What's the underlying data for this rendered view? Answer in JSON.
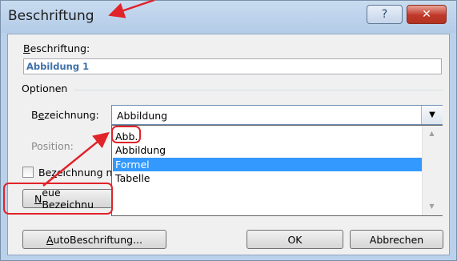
{
  "window": {
    "title": "Beschriftung",
    "help_glyph": "?",
    "close_glyph": "✕"
  },
  "caption": {
    "label_accel": "B",
    "label_rest": "eschriftung:",
    "value": "Abbildung 1"
  },
  "options": {
    "group_label": "Optionen",
    "label_field_pre": "B",
    "label_field_accel": "e",
    "label_field_post": "zeichnung:",
    "label_value": "Abbildung",
    "dropdown_arrow": "▼",
    "dropdown_items": [
      "Abb.",
      "Abbildung",
      "Formel",
      "Tabelle"
    ],
    "selected_index": 2,
    "position_label": "Position:",
    "exclude_label_pre": "Be",
    "exclude_label_accel": "z",
    "exclude_label_post": "eichnung n",
    "exclude_checked": false,
    "scroll_up_glyph": "▲",
    "scroll_down_glyph": "▼"
  },
  "buttons": {
    "new_label_accel": "N",
    "new_label_rest": "eue Bezeichnu",
    "autocaption_accel": "A",
    "autocaption_rest": "utoBeschriftung...",
    "ok": "OK",
    "cancel": "Abbrechen"
  },
  "annotation": {
    "color": "#e1232a"
  }
}
